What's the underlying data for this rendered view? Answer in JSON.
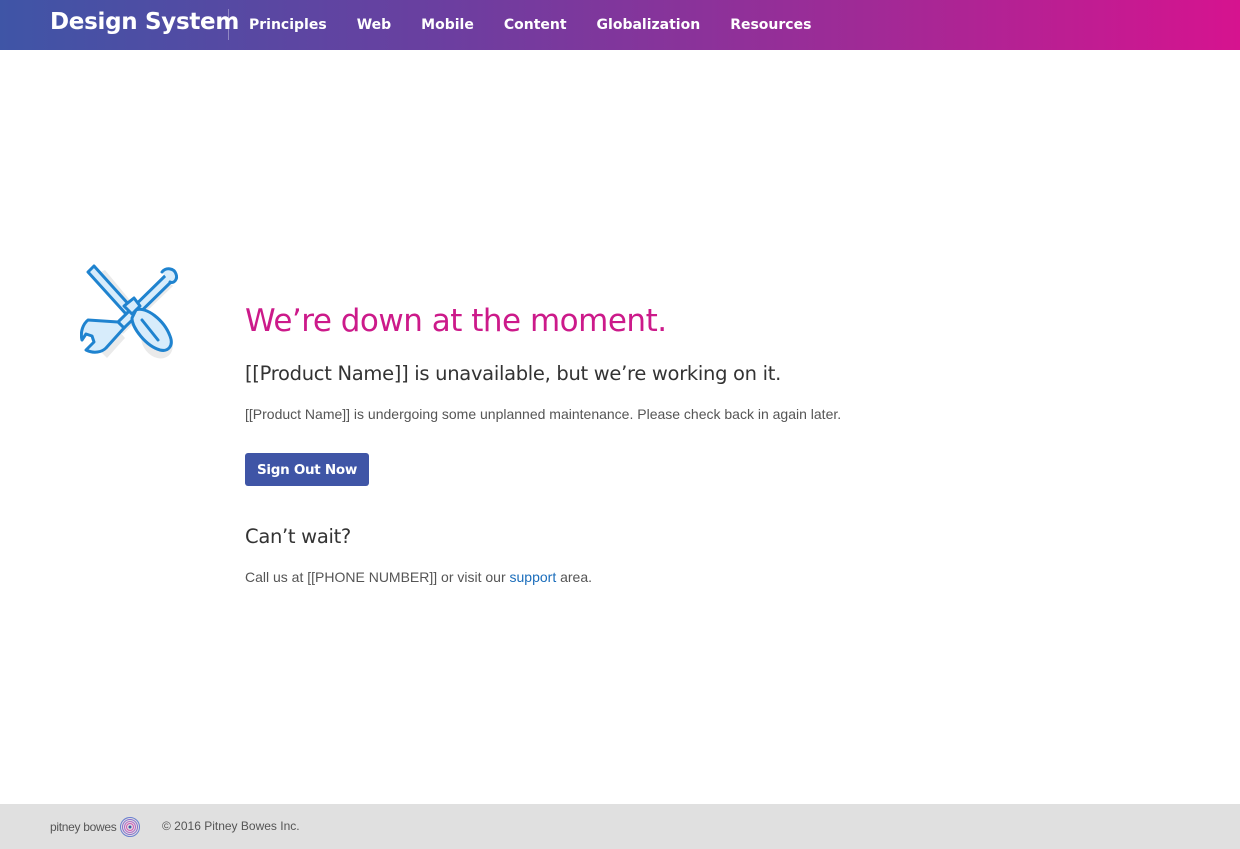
{
  "header": {
    "brand": "Design System",
    "nav": [
      {
        "label": "Principles"
      },
      {
        "label": "Web"
      },
      {
        "label": "Mobile"
      },
      {
        "label": "Content"
      },
      {
        "label": "Globalization"
      },
      {
        "label": "Resources"
      }
    ],
    "gradient_colors": [
      "#3f55a6",
      "#d6138f"
    ]
  },
  "main": {
    "icon": "wrench-screwdriver-icon",
    "headline": "We’re down at the moment.",
    "subhead": "[[Product Name]] is unavailable, but we’re working on it.",
    "body": "[[Product Name]] is undergoing some unplanned maintenance. Please check back in again later.",
    "button_label": "Sign Out Now",
    "cant_wait": "Can’t wait?",
    "call_prefix": "Call us at [[PHONE NUMBER]] or visit our ",
    "support_link": "support",
    "call_suffix": " area.",
    "headline_color": "#cc1a8a",
    "button_color": "#3f55a6",
    "link_color": "#1a6dbb"
  },
  "footer": {
    "logo_text": "pitney bowes",
    "copyright": "© 2016 Pitney Bowes Inc."
  }
}
